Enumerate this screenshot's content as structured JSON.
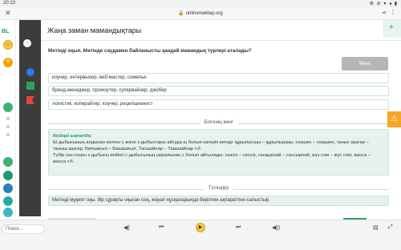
{
  "status": {
    "time": "20:10",
    "right_icons": "⚙ ⊘ ▾ ◂ ▮"
  },
  "url_bar": {
    "url": "onlinemektep.org",
    "close": "✕",
    "share": "⋖",
    "more": "⋮"
  },
  "left_rail": {
    "logo": "BL",
    "avatar": "☺",
    "coin": "₸"
  },
  "topic": "Жаңа заман мамандықтары",
  "question": "Мәтінді оқып. Мәтінде саудамен байланысты қандай мамандық түрлері аталады?",
  "menu_button": "Мені",
  "options": [
    "коучер, интервьюер, веб-мастер, сомелье",
    "бренд-менеджер, промоутер, супервайзер, джобер",
    "логистик, копирайтер, коучер, рецепшионист"
  ],
  "section_know": "Білгенің жөн!",
  "info": {
    "title": "Кейіңгі ықпалда:",
    "p1": "Ш дыбысының алдынан келген с және з дыбыстары айтуда ш болып өзгеріп кетеді: құрылысшы – құрылышшы, сезшен – сешшен, таныс шығар – таныш шығар, Бөпшағыл – Бөшшағыл, Тасшайнар – Ташшайнар т.б.",
    "p2": "Түбір сөз соңғы з дыбысы кейінгі с дыбысының ықпалынан с болып айтылады: сөзсіз – сөссіз, сасқырнай – сассырнай, жүз сом – жүс сом, жасса – жасса т.б."
  },
  "section_understand": "Түсіндіру",
  "instruction": "Мәтінді мұқият оқы. Әр сұрақты оқыған соң, жауап нұсқаларында берілген ақпаратпен салыстыр.",
  "taskbar": {
    "search_placeholder": "Поиск..."
  }
}
